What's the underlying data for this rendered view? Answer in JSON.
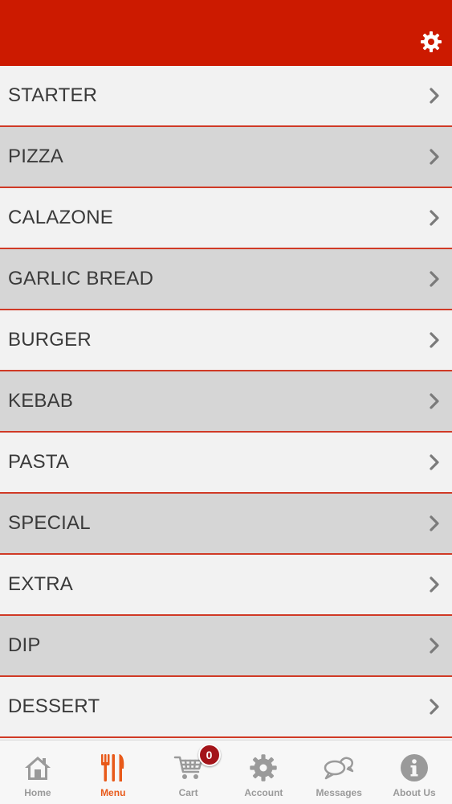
{
  "colors": {
    "header": "#cc1a00",
    "divider": "#d03a26",
    "row_light": "#f2f2f2",
    "row_dark": "#d6d6d6",
    "active_tab": "#e85a1a",
    "inactive_tab": "#9a9a9a",
    "badge": "#a3141a"
  },
  "header": {
    "settings_icon": "gear-icon"
  },
  "menu": {
    "items": [
      {
        "label": "STARTER"
      },
      {
        "label": "PIZZA"
      },
      {
        "label": "CALAZONE"
      },
      {
        "label": "GARLIC BREAD"
      },
      {
        "label": "BURGER"
      },
      {
        "label": "KEBAB"
      },
      {
        "label": "PASTA"
      },
      {
        "label": "SPECIAL"
      },
      {
        "label": "EXTRA"
      },
      {
        "label": "DIP"
      },
      {
        "label": "DESSERT"
      }
    ]
  },
  "tabbar": {
    "tabs": [
      {
        "label": "Home",
        "icon": "home-icon"
      },
      {
        "label": "Menu",
        "icon": "cutlery-icon",
        "active": true
      },
      {
        "label": "Cart",
        "icon": "cart-icon",
        "badge": "0"
      },
      {
        "label": "Account",
        "icon": "gear-icon"
      },
      {
        "label": "Messages",
        "icon": "chat-bubbles-icon"
      },
      {
        "label": "About Us",
        "icon": "info-icon"
      }
    ]
  }
}
